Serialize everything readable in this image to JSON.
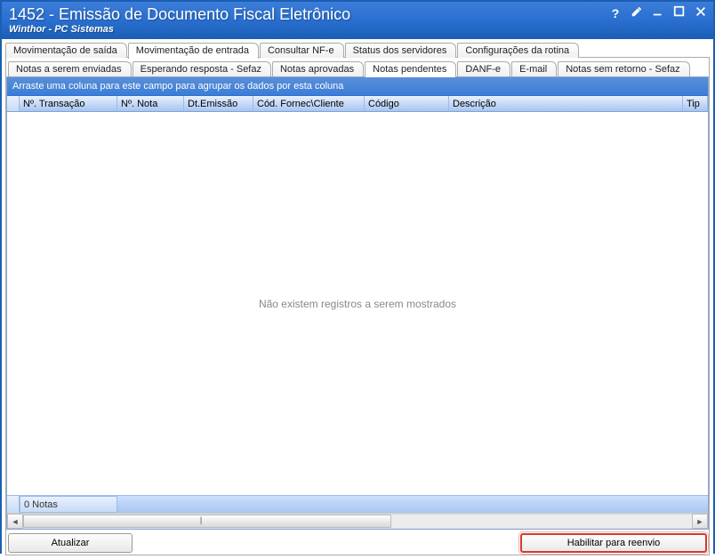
{
  "titlebar": {
    "title": "1452 - Emissão de Documento Fiscal Eletrônico",
    "subtitle": "Winthor - PC Sistemas"
  },
  "primaryTabs": {
    "t0": "Movimentação de saída",
    "t1": "Movimentação de entrada",
    "t2": "Consultar NF-e",
    "t3": "Status dos servidores",
    "t4": "Configurações da rotina"
  },
  "secondaryTabs": {
    "s0": "Notas a serem enviadas",
    "s1": "Esperando resposta - Sefaz",
    "s2": "Notas aprovadas",
    "s3": "Notas pendentes",
    "s4": "DANF-e",
    "s5": "E-mail",
    "s6": "Notas sem retorno - Sefaz"
  },
  "grid": {
    "groupHint": "Arraste uma coluna para este campo para agrupar os dados por esta coluna",
    "columns": {
      "c0": "Nº. Transação",
      "c1": "Nº. Nota",
      "c2": "Dt.Emissão",
      "c3": "Cód. Fornec\\Cliente",
      "c4": "Código",
      "c5": "Descrição",
      "c6": "Tip"
    },
    "emptyText": "Não existem registros a serem mostrados",
    "footerCount": "0 Notas"
  },
  "buttons": {
    "update": "Atualizar",
    "resend": "Habilitar para reenvio"
  }
}
